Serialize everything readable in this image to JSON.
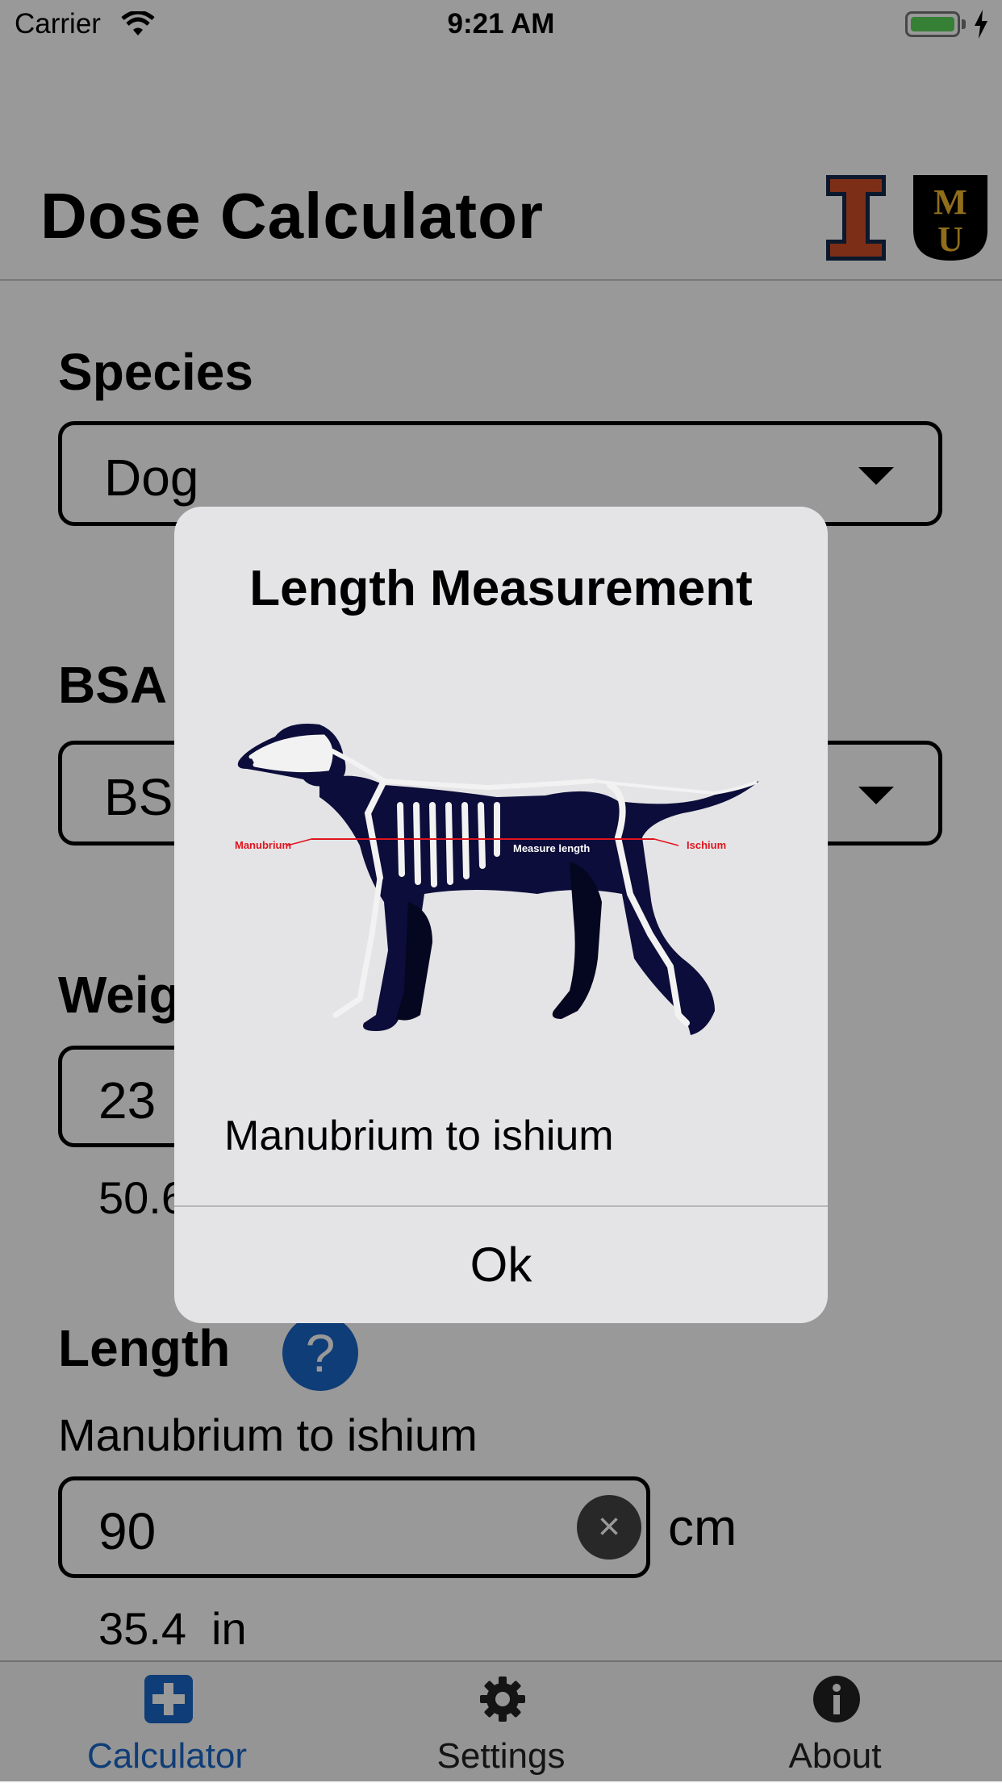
{
  "status_bar": {
    "carrier": "Carrier",
    "time": "9:21 AM",
    "wifi_icon": "wifi-icon",
    "battery_icon": "battery-icon"
  },
  "header": {
    "title": "Dose Calculator",
    "logos": [
      "illinois-logo",
      "mizzou-logo"
    ]
  },
  "species": {
    "label": "Species",
    "value": "Dog"
  },
  "bsa": {
    "label": "BSA",
    "value": "BS"
  },
  "weight": {
    "label": "Weig",
    "value": "23",
    "converted": "50.6"
  },
  "length": {
    "label": "Length",
    "help_label": "?",
    "description": "Manubrium to ishium",
    "value": "90",
    "unit": "cm",
    "converted": "35.4",
    "converted_unit": "in",
    "clear_label": "×"
  },
  "tab_bar": {
    "tabs": [
      {
        "label": "Calculator",
        "icon": "plus-icon",
        "active": true
      },
      {
        "label": "Settings",
        "icon": "gear-icon",
        "active": false
      },
      {
        "label": "About",
        "icon": "info-icon",
        "active": false
      }
    ],
    "active_color": "#1a66c7"
  },
  "dialog": {
    "title": "Length Measurement",
    "image_labels": {
      "left": "Manubrium",
      "center": "Measure length",
      "right": "Ischium"
    },
    "message": "Manubrium to ishium",
    "ok_label": "Ok"
  }
}
